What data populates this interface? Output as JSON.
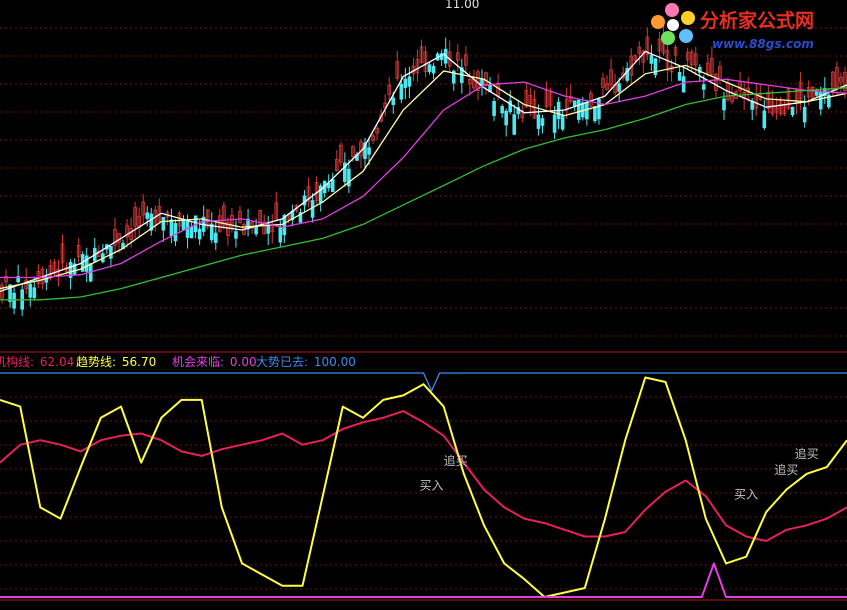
{
  "colors": {
    "background": "#000000",
    "grid": "#7a1010",
    "divider": "#b01818",
    "candle_up": "#d83a3a",
    "candle_down": "#4ce8f0",
    "ma_short": "#ffffff",
    "ma_mid": "#ffffaa",
    "ma_long": "#e040e0",
    "ma_slow": "#30c030",
    "trend_line": "#ffff40",
    "inst_line": "#e8205a",
    "opportunity_line": "#e040e0",
    "trend_gone_line": "#3a8cf0",
    "annotation": "#c0c0c0",
    "logo_red": "#e83020",
    "logo_blue": "#2a4cc8"
  },
  "logo": {
    "name": "分析家公式网",
    "url": "www.88gs.com"
  },
  "price_panel": {
    "peak_label": "11.00"
  },
  "indicator_panel": {
    "legend": [
      {
        "label": "机构线:",
        "value": "62.04",
        "color": "#e8205a"
      },
      {
        "label": "趋势线:",
        "value": "56.70",
        "color": "#ffff40"
      },
      {
        "label": "机会来临:",
        "value": "0.00",
        "color": "#e040e0"
      },
      {
        "label": "大势已去:",
        "value": "100.00",
        "color": "#3a8cf0"
      }
    ],
    "annotations": [
      {
        "text": "买入",
        "x": 104,
        "y": 48
      },
      {
        "text": "追买",
        "x": 110,
        "y": 59
      },
      {
        "text": "买入",
        "x": 182,
        "y": 44
      },
      {
        "text": "追买",
        "x": 192,
        "y": 55
      },
      {
        "text": "追买",
        "x": 197,
        "y": 62
      }
    ]
  },
  "chart_data": [
    {
      "type": "candlestick",
      "title": "",
      "xlabel": "",
      "ylabel": "",
      "x_range": [
        0,
        210
      ],
      "y_range": [
        5.0,
        11.2
      ],
      "grid": true,
      "series": [
        {
          "kind": "ma",
          "points": [
            [
              0,
              6.05
            ],
            [
              10,
              6.3
            ],
            [
              20,
              6.55
            ],
            [
              30,
              7.0
            ],
            [
              40,
              7.45
            ],
            [
              50,
              7.25
            ],
            [
              60,
              7.15
            ],
            [
              70,
              7.35
            ],
            [
              80,
              7.9
            ],
            [
              90,
              8.6
            ],
            [
              100,
              9.9
            ],
            [
              110,
              10.3
            ],
            [
              120,
              9.7
            ],
            [
              130,
              9.25
            ],
            [
              140,
              9.3
            ],
            [
              150,
              9.55
            ],
            [
              160,
              10.35
            ],
            [
              170,
              10.05
            ],
            [
              180,
              9.65
            ],
            [
              190,
              9.35
            ],
            [
              200,
              9.45
            ],
            [
              210,
              9.75
            ]
          ]
        },
        {
          "kind": "ma",
          "points": [
            [
              0,
              6.1
            ],
            [
              10,
              6.25
            ],
            [
              20,
              6.45
            ],
            [
              30,
              6.8
            ],
            [
              40,
              7.3
            ],
            [
              50,
              7.35
            ],
            [
              60,
              7.2
            ],
            [
              70,
              7.25
            ],
            [
              80,
              7.65
            ],
            [
              90,
              8.2
            ],
            [
              100,
              9.3
            ],
            [
              110,
              10.0
            ],
            [
              120,
              9.85
            ],
            [
              130,
              9.4
            ],
            [
              140,
              9.2
            ],
            [
              150,
              9.4
            ],
            [
              160,
              9.95
            ],
            [
              170,
              10.1
            ],
            [
              180,
              9.8
            ],
            [
              190,
              9.5
            ],
            [
              200,
              9.45
            ],
            [
              210,
              9.6
            ]
          ]
        },
        {
          "kind": "ma",
          "points": [
            [
              0,
              6.3
            ],
            [
              10,
              6.3
            ],
            [
              20,
              6.35
            ],
            [
              30,
              6.55
            ],
            [
              40,
              6.95
            ],
            [
              50,
              7.3
            ],
            [
              60,
              7.35
            ],
            [
              70,
              7.2
            ],
            [
              80,
              7.35
            ],
            [
              90,
              7.75
            ],
            [
              100,
              8.45
            ],
            [
              110,
              9.3
            ],
            [
              120,
              9.75
            ],
            [
              130,
              9.8
            ],
            [
              140,
              9.55
            ],
            [
              150,
              9.4
            ],
            [
              160,
              9.55
            ],
            [
              170,
              9.8
            ],
            [
              180,
              9.85
            ],
            [
              190,
              9.75
            ],
            [
              200,
              9.65
            ],
            [
              210,
              9.6
            ]
          ]
        },
        {
          "kind": "ma",
          "points": [
            [
              0,
              5.9
            ],
            [
              10,
              5.9
            ],
            [
              20,
              5.95
            ],
            [
              30,
              6.1
            ],
            [
              40,
              6.3
            ],
            [
              50,
              6.5
            ],
            [
              60,
              6.7
            ],
            [
              70,
              6.85
            ],
            [
              80,
              7.0
            ],
            [
              90,
              7.25
            ],
            [
              100,
              7.6
            ],
            [
              110,
              7.95
            ],
            [
              120,
              8.3
            ],
            [
              130,
              8.6
            ],
            [
              140,
              8.8
            ],
            [
              150,
              8.95
            ],
            [
              160,
              9.15
            ],
            [
              170,
              9.4
            ],
            [
              180,
              9.55
            ],
            [
              190,
              9.6
            ],
            [
              200,
              9.65
            ],
            [
              210,
              9.7
            ]
          ]
        }
      ]
    },
    {
      "type": "line",
      "title": "",
      "xlabel": "",
      "ylabel": "",
      "x_range": [
        0,
        210
      ],
      "y_range": [
        0,
        100
      ],
      "grid": true,
      "series": [
        {
          "name": "机构线",
          "points": [
            [
              0,
              60
            ],
            [
              5,
              68
            ],
            [
              10,
              70
            ],
            [
              15,
              68
            ],
            [
              20,
              65
            ],
            [
              25,
              70
            ],
            [
              30,
              72
            ],
            [
              35,
              73
            ],
            [
              40,
              70
            ],
            [
              45,
              65
            ],
            [
              50,
              63
            ],
            [
              55,
              66
            ],
            [
              60,
              68
            ],
            [
              65,
              70
            ],
            [
              70,
              73
            ],
            [
              75,
              68
            ],
            [
              80,
              70
            ],
            [
              85,
              75
            ],
            [
              90,
              78
            ],
            [
              95,
              80
            ],
            [
              100,
              83
            ],
            [
              105,
              78
            ],
            [
              110,
              72
            ],
            [
              115,
              60
            ],
            [
              120,
              48
            ],
            [
              125,
              40
            ],
            [
              130,
              35
            ],
            [
              135,
              33
            ],
            [
              140,
              30
            ],
            [
              145,
              27
            ],
            [
              150,
              27
            ],
            [
              155,
              29
            ],
            [
              160,
              39
            ],
            [
              165,
              47
            ],
            [
              170,
              52
            ],
            [
              175,
              45
            ],
            [
              180,
              32
            ],
            [
              185,
              27
            ],
            [
              190,
              25
            ],
            [
              195,
              30
            ],
            [
              200,
              32
            ],
            [
              205,
              35
            ],
            [
              210,
              40
            ]
          ]
        },
        {
          "name": "趋势线",
          "points": [
            [
              0,
              88
            ],
            [
              5,
              85
            ],
            [
              10,
              40
            ],
            [
              15,
              35
            ],
            [
              20,
              58
            ],
            [
              25,
              80
            ],
            [
              30,
              85
            ],
            [
              35,
              60
            ],
            [
              40,
              80
            ],
            [
              45,
              88
            ],
            [
              50,
              88
            ],
            [
              55,
              40
            ],
            [
              60,
              15
            ],
            [
              65,
              10
            ],
            [
              70,
              5
            ],
            [
              75,
              5
            ],
            [
              80,
              45
            ],
            [
              85,
              85
            ],
            [
              90,
              80
            ],
            [
              95,
              88
            ],
            [
              100,
              90
            ],
            [
              105,
              95
            ],
            [
              110,
              85
            ],
            [
              115,
              55
            ],
            [
              120,
              32
            ],
            [
              125,
              15
            ],
            [
              130,
              8
            ],
            [
              135,
              0
            ],
            [
              140,
              2
            ],
            [
              145,
              4
            ],
            [
              150,
              35
            ],
            [
              155,
              70
            ],
            [
              160,
              98
            ],
            [
              165,
              96
            ],
            [
              170,
              70
            ],
            [
              175,
              35
            ],
            [
              180,
              15
            ],
            [
              185,
              18
            ],
            [
              190,
              38
            ],
            [
              195,
              48
            ],
            [
              200,
              55
            ],
            [
              205,
              58
            ],
            [
              210,
              70
            ]
          ]
        },
        {
          "name": "机会来临",
          "points": [
            [
              0,
              0
            ],
            [
              174,
              0
            ],
            [
              177,
              15
            ],
            [
              180,
              0
            ],
            [
              210,
              0
            ]
          ]
        },
        {
          "name": "大势已去",
          "points": [
            [
              0,
              100
            ],
            [
              105,
              100
            ],
            [
              107,
              92
            ],
            [
              109,
              100
            ],
            [
              210,
              100
            ]
          ]
        }
      ]
    }
  ]
}
